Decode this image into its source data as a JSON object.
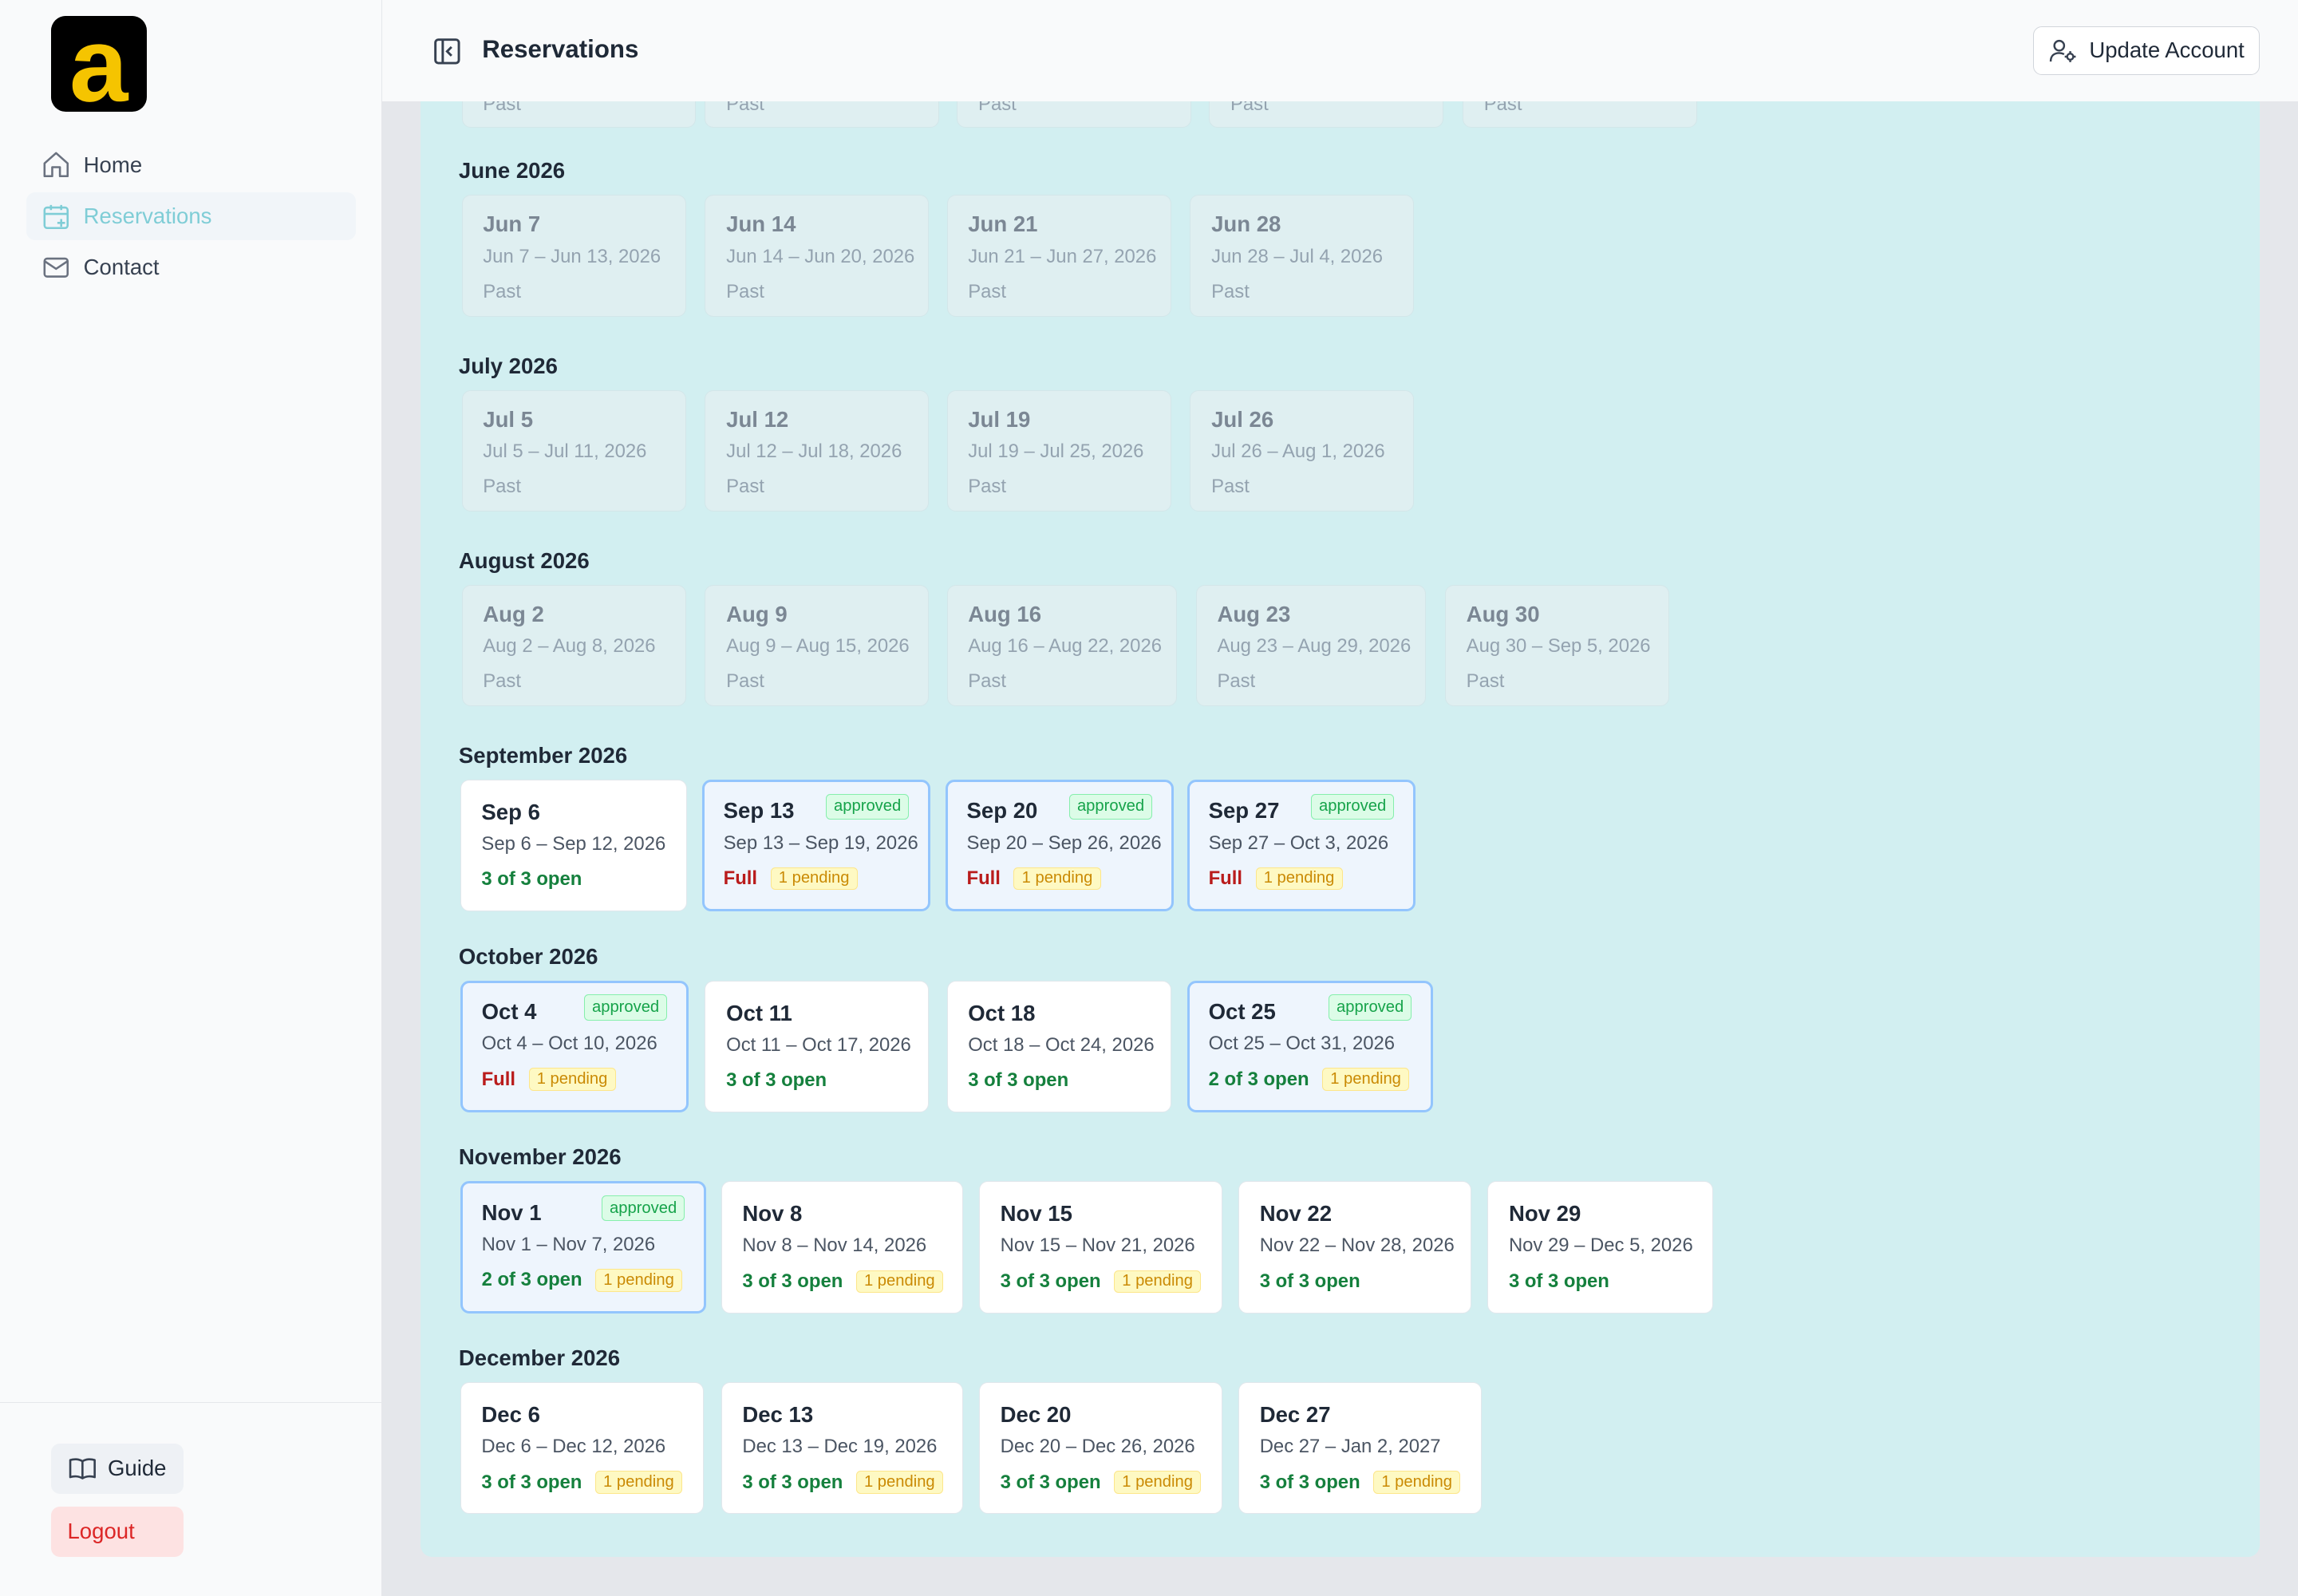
{
  "sidebar": {
    "logo_text": "a",
    "nav": [
      {
        "label": "Home",
        "icon": "home-icon",
        "active": false
      },
      {
        "label": "Reservations",
        "icon": "calendar-plus-icon",
        "active": true
      },
      {
        "label": "Contact",
        "icon": "mail-icon",
        "active": false
      }
    ],
    "guide_label": "Guide",
    "logout_label": "Logout"
  },
  "header": {
    "title": "Reservations",
    "update_account_label": "Update Account"
  },
  "colors": {
    "accent": "#7fcdd6",
    "panel_bg": "#d2eff1",
    "open_green": "#15803d",
    "full_red": "#b91c1c",
    "pending_amber": "#ca8a04",
    "approved_border": "#93c5fd",
    "logo_yellow": "#f5c400"
  },
  "top_row_partial": [
    "Past",
    "Past",
    "Past",
    "Past",
    "Past"
  ],
  "months": [
    {
      "label": "June 2026",
      "weeks": [
        {
          "date": "Jun 7",
          "range": "Jun 7 – Jun 13, 2026",
          "kind": "past",
          "status": "Past"
        },
        {
          "date": "Jun 14",
          "range": "Jun 14 – Jun 20, 2026",
          "kind": "past",
          "status": "Past"
        },
        {
          "date": "Jun 21",
          "range": "Jun 21 – Jun 27, 2026",
          "kind": "past",
          "status": "Past"
        },
        {
          "date": "Jun 28",
          "range": "Jun 28 – Jul 4, 2026",
          "kind": "past",
          "status": "Past"
        }
      ]
    },
    {
      "label": "July 2026",
      "weeks": [
        {
          "date": "Jul 5",
          "range": "Jul 5 – Jul 11, 2026",
          "kind": "past",
          "status": "Past"
        },
        {
          "date": "Jul 12",
          "range": "Jul 12 – Jul 18, 2026",
          "kind": "past",
          "status": "Past"
        },
        {
          "date": "Jul 19",
          "range": "Jul 19 – Jul 25, 2026",
          "kind": "past",
          "status": "Past"
        },
        {
          "date": "Jul 26",
          "range": "Jul 26 – Aug 1, 2026",
          "kind": "past",
          "status": "Past"
        }
      ]
    },
    {
      "label": "August 2026",
      "weeks": [
        {
          "date": "Aug 2",
          "range": "Aug 2 – Aug 8, 2026",
          "kind": "past",
          "status": "Past"
        },
        {
          "date": "Aug 9",
          "range": "Aug 9 – Aug 15, 2026",
          "kind": "past",
          "status": "Past"
        },
        {
          "date": "Aug 16",
          "range": "Aug 16 – Aug 22, 2026",
          "kind": "past",
          "status": "Past"
        },
        {
          "date": "Aug 23",
          "range": "Aug 23 – Aug 29, 2026",
          "kind": "past",
          "status": "Past"
        },
        {
          "date": "Aug 30",
          "range": "Aug 30 – Sep 5, 2026",
          "kind": "past",
          "status": "Past"
        }
      ]
    },
    {
      "label": "September 2026",
      "weeks": [
        {
          "date": "Sep 6",
          "range": "Sep 6 – Sep 12, 2026",
          "kind": "open",
          "status": "3 of 3 open"
        },
        {
          "date": "Sep 13",
          "range": "Sep 13 – Sep 19, 2026",
          "kind": "approved",
          "badge": "approved",
          "status": "Full",
          "pending": "1 pending"
        },
        {
          "date": "Sep 20",
          "range": "Sep 20 – Sep 26, 2026",
          "kind": "approved",
          "badge": "approved",
          "status": "Full",
          "pending": "1 pending"
        },
        {
          "date": "Sep 27",
          "range": "Sep 27 – Oct 3, 2026",
          "kind": "approved",
          "badge": "approved",
          "status": "Full",
          "pending": "1 pending"
        }
      ]
    },
    {
      "label": "October 2026",
      "weeks": [
        {
          "date": "Oct 4",
          "range": "Oct 4 – Oct 10, 2026",
          "kind": "approved",
          "badge": "approved",
          "status": "Full",
          "pending": "1 pending"
        },
        {
          "date": "Oct 11",
          "range": "Oct 11 – Oct 17, 2026",
          "kind": "open",
          "status": "3 of 3 open"
        },
        {
          "date": "Oct 18",
          "range": "Oct 18 – Oct 24, 2026",
          "kind": "open",
          "status": "3 of 3 open"
        },
        {
          "date": "Oct 25",
          "range": "Oct 25 – Oct 31, 2026",
          "kind": "approved",
          "badge": "approved",
          "status": "2 of 3 open",
          "pending": "1 pending"
        }
      ]
    },
    {
      "label": "November 2026",
      "weeks": [
        {
          "date": "Nov 1",
          "range": "Nov 1 – Nov 7, 2026",
          "kind": "approved",
          "badge": "approved",
          "status": "2 of 3 open",
          "pending": "1 pending"
        },
        {
          "date": "Nov 8",
          "range": "Nov 8 – Nov 14, 2026",
          "kind": "open",
          "status": "3 of 3 open",
          "pending": "1 pending"
        },
        {
          "date": "Nov 15",
          "range": "Nov 15 – Nov 21, 2026",
          "kind": "open",
          "status": "3 of 3 open",
          "pending": "1 pending"
        },
        {
          "date": "Nov 22",
          "range": "Nov 22 – Nov 28, 2026",
          "kind": "open",
          "status": "3 of 3 open"
        },
        {
          "date": "Nov 29",
          "range": "Nov 29 – Dec 5, 2026",
          "kind": "open",
          "status": "3 of 3 open"
        }
      ]
    },
    {
      "label": "December 2026",
      "weeks": [
        {
          "date": "Dec 6",
          "range": "Dec 6 – Dec 12, 2026",
          "kind": "open",
          "status": "3 of 3 open",
          "pending": "1 pending"
        },
        {
          "date": "Dec 13",
          "range": "Dec 13 – Dec 19, 2026",
          "kind": "open",
          "status": "3 of 3 open",
          "pending": "1 pending"
        },
        {
          "date": "Dec 20",
          "range": "Dec 20 – Dec 26, 2026",
          "kind": "open",
          "status": "3 of 3 open",
          "pending": "1 pending"
        },
        {
          "date": "Dec 27",
          "range": "Dec 27 – Jan 2, 2027",
          "kind": "open",
          "status": "3 of 3 open",
          "pending": "1 pending"
        }
      ]
    }
  ]
}
